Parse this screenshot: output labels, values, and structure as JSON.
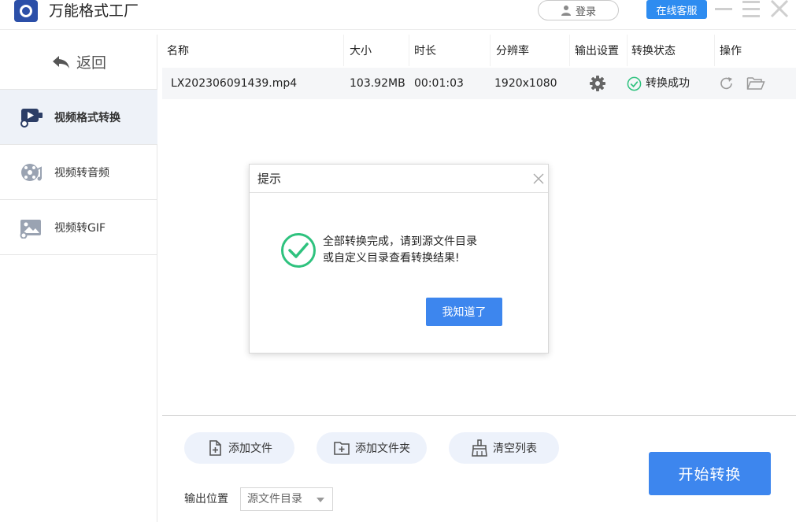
{
  "app": {
    "title": "万能格式工厂",
    "login_label": "登录",
    "service_label": "在线客服"
  },
  "sidebar": {
    "back_label": "返回",
    "items": [
      {
        "label": "视频格式转换",
        "icon": "video-convert-icon",
        "active": true
      },
      {
        "label": "视频转音频",
        "icon": "audio-convert-icon",
        "active": false
      },
      {
        "label": "视频转GIF",
        "icon": "gif-image-icon",
        "active": false
      }
    ]
  },
  "table": {
    "headers": [
      "名称",
      "大小",
      "时长",
      "分辨率",
      "输出设置",
      "转换状态",
      "操作"
    ],
    "rows": [
      {
        "name": "LX202306091439.mp4",
        "size": "103.92MB",
        "duration": "00:01:03",
        "resolution": "1920x1080",
        "status": "转换成功"
      }
    ]
  },
  "actions": {
    "add_file": "添加文件",
    "add_folder": "添加文件夹",
    "clear_list": "清空列表",
    "start": "开始转换"
  },
  "output": {
    "label": "输出位置",
    "selected": "源文件目录"
  },
  "dialog": {
    "title": "提示",
    "message_line1": "全部转换完成，请到源文件目录",
    "message_line2": "或自定义目录查看转换结果!",
    "ok_label": "我知道了"
  },
  "colors": {
    "accent": "#3d86ee",
    "service": "#2e8cf0",
    "success": "#2ec27e",
    "pill_bg": "#edf2fb"
  }
}
